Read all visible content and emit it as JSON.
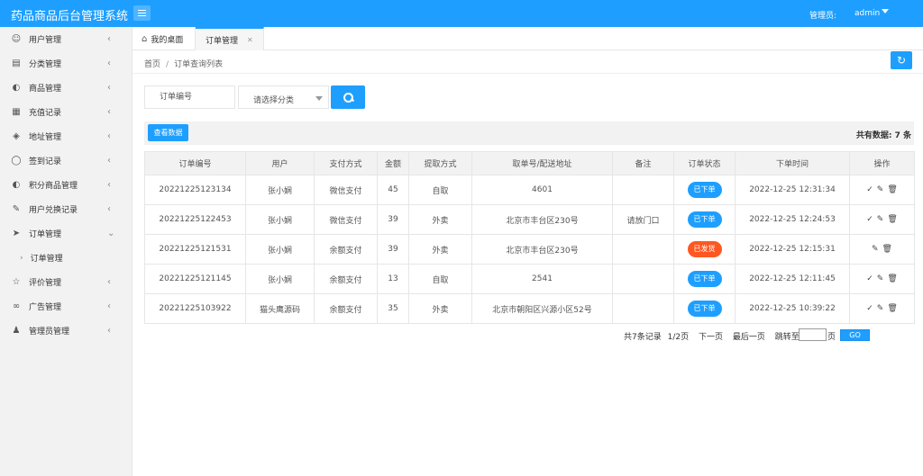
{
  "app": {
    "title": "药品商品后台管理系统"
  },
  "header": {
    "admin_label": "管理员:",
    "admin_name": "admin"
  },
  "sidebar": {
    "items": [
      {
        "label": "用户管理",
        "icon": "user-icon"
      },
      {
        "label": "分类管理",
        "icon": "category-icon"
      },
      {
        "label": "商品管理",
        "icon": "dashboard-icon"
      },
      {
        "label": "充值记录",
        "icon": "calendar-icon"
      },
      {
        "label": "地址管理",
        "icon": "layers-icon"
      },
      {
        "label": "签到记录",
        "icon": "shield-icon"
      },
      {
        "label": "积分商品管理",
        "icon": "gauge-icon"
      },
      {
        "label": "用户兑换记录",
        "icon": "form-icon"
      },
      {
        "label": "订单管理",
        "icon": "send-icon",
        "expanded": true,
        "sub": [
          {
            "label": "订单管理"
          }
        ]
      },
      {
        "label": "评价管理",
        "icon": "star-icon"
      },
      {
        "label": "广告管理",
        "icon": "link-icon"
      },
      {
        "label": "管理员管理",
        "icon": "person-icon"
      }
    ]
  },
  "tabs": [
    {
      "label": "我的桌面"
    },
    {
      "label": "订单管理"
    }
  ],
  "breadcrumb": {
    "home": "首页",
    "sep": "/",
    "current": "订单查询列表"
  },
  "search": {
    "placeholder": "订单编号",
    "select_label": "请选择分类"
  },
  "toolbar": {
    "query_label": "查看数据",
    "total_text": "共有数据: 7 条"
  },
  "table": {
    "headers": [
      "订单编号",
      "用户",
      "支付方式",
      "金额",
      "提取方式",
      "取单号/配送地址",
      "备注",
      "订单状态",
      "下单时间",
      "操作"
    ],
    "rows": [
      {
        "order_no": "20221225123134",
        "user": "张小娴",
        "pay": "微信支付",
        "amount": "45",
        "pickup": "自取",
        "address": "4601",
        "note": "",
        "status": "已下单",
        "status_color": "#1e9fff",
        "time": "2022-12-25 12:31:34",
        "actions": [
          "check",
          "edit",
          "delete"
        ]
      },
      {
        "order_no": "20221225122453",
        "user": "张小娴",
        "pay": "微信支付",
        "amount": "39",
        "pickup": "外卖",
        "address": "北京市丰台区230号",
        "note": "请放门口",
        "status": "已下单",
        "status_color": "#1e9fff",
        "time": "2022-12-25 12:24:53",
        "actions": [
          "check",
          "edit",
          "delete"
        ]
      },
      {
        "order_no": "20221225121531",
        "user": "张小娴",
        "pay": "余额支付",
        "amount": "39",
        "pickup": "外卖",
        "address": "北京市丰台区230号",
        "note": "",
        "status": "已发货",
        "status_color": "#ff5722",
        "time": "2022-12-25 12:15:31",
        "actions": [
          "edit",
          "delete"
        ]
      },
      {
        "order_no": "20221225121145",
        "user": "张小娴",
        "pay": "余额支付",
        "amount": "13",
        "pickup": "自取",
        "address": "2541",
        "note": "",
        "status": "已下单",
        "status_color": "#1e9fff",
        "time": "2022-12-25 12:11:45",
        "actions": [
          "check",
          "edit",
          "delete"
        ]
      },
      {
        "order_no": "20221225103922",
        "user": "猫头鹰源码",
        "pay": "余额支付",
        "amount": "35",
        "pickup": "外卖",
        "address": "北京市朝阳区兴源小区52号",
        "note": "",
        "status": "已下单",
        "status_color": "#1e9fff",
        "time": "2022-12-25 10:39:22",
        "actions": [
          "check",
          "edit",
          "delete"
        ]
      }
    ]
  },
  "pager": {
    "records": "共7条记录",
    "page": "1/2页",
    "next": "下一页",
    "last": "最后一页",
    "jump_label": "跳转至",
    "jump_suffix": "页",
    "go": "GO"
  },
  "colors": {
    "primary": "#1e9fff",
    "danger": "#ff5722",
    "sidebar_bg": "#f2f2f2"
  }
}
